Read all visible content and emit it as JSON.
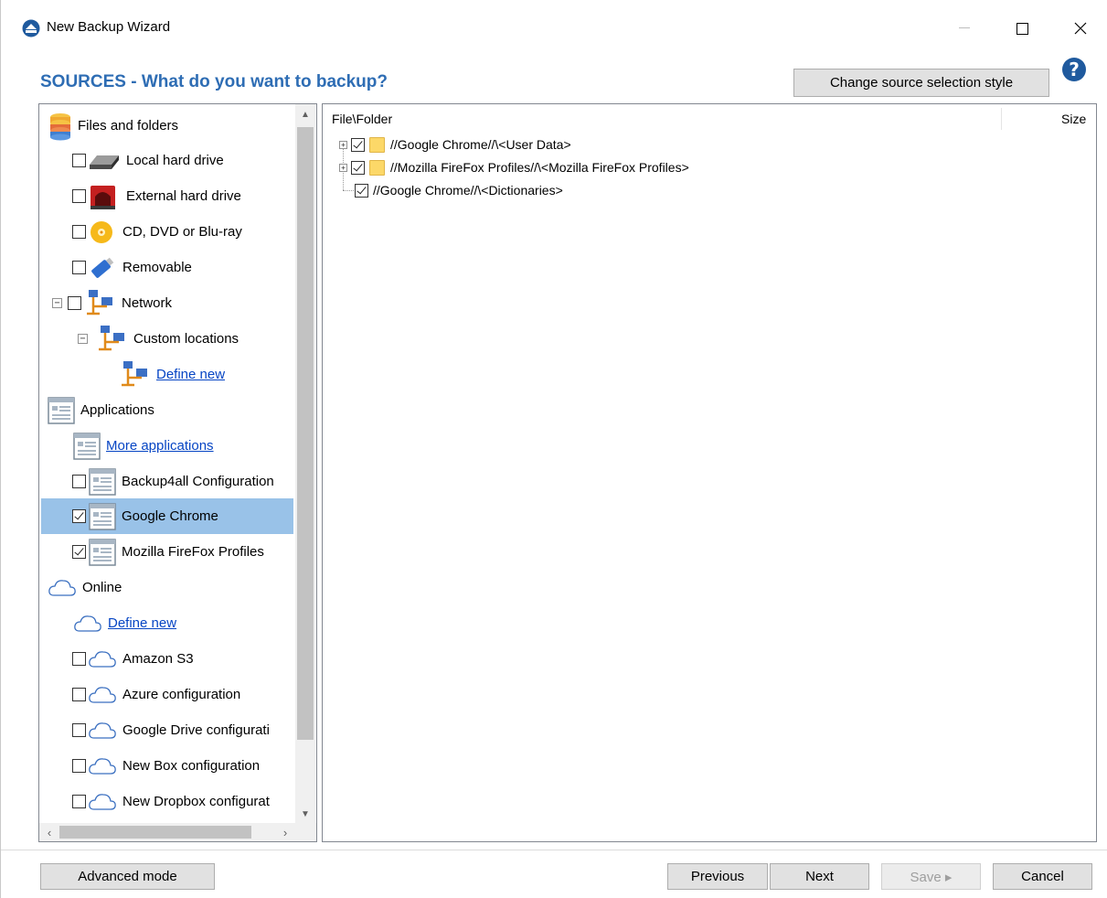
{
  "window": {
    "title": "New Backup Wizard",
    "minimize_label": "—",
    "maximize_label": "☐",
    "close_label": "✕"
  },
  "header": {
    "title": "SOURCES - What do you want to backup?",
    "change_style_label": "Change source selection style",
    "help_label": "?"
  },
  "sources_tree": {
    "items": [
      {
        "label": "Files and folders",
        "icon": "database-icon"
      },
      {
        "label": "Local hard drive",
        "icon": "hard-drive-icon",
        "checked": false
      },
      {
        "label": "External hard drive",
        "icon": "external-drive-icon",
        "checked": false
      },
      {
        "label": "CD, DVD or Blu-ray",
        "icon": "disc-icon",
        "checked": false
      },
      {
        "label": "Removable",
        "icon": "usb-drive-icon",
        "checked": false
      },
      {
        "label": "Network",
        "icon": "network-icon",
        "checked": false,
        "expander": "⊟"
      },
      {
        "label": "Custom locations",
        "icon": "network-icon",
        "expander": "⊟"
      },
      {
        "label": "Define new",
        "icon": "network-icon",
        "link": true
      },
      {
        "label": "Applications",
        "icon": "application-icon"
      },
      {
        "label": "More applications",
        "icon": "application-icon",
        "link": true
      },
      {
        "label": "Backup4all Configuration",
        "icon": "application-icon",
        "checked": false
      },
      {
        "label": "Google Chrome",
        "icon": "application-icon",
        "checked": true,
        "selected": true
      },
      {
        "label": "Mozilla FireFox Profiles",
        "icon": "application-icon",
        "checked": true
      },
      {
        "label": "Online",
        "icon": "cloud-icon"
      },
      {
        "label": "Define new",
        "icon": "cloud-icon",
        "link": true
      },
      {
        "label": "Amazon S3",
        "icon": "cloud-icon",
        "checked": false
      },
      {
        "label": "Azure configuration",
        "icon": "cloud-icon",
        "checked": false
      },
      {
        "label": "Google Drive configurati",
        "icon": "cloud-icon",
        "checked": false
      },
      {
        "label": "New Box configuration",
        "icon": "cloud-icon",
        "checked": false
      },
      {
        "label": "New Dropbox configurat",
        "icon": "cloud-icon",
        "checked": false
      }
    ]
  },
  "file_list": {
    "columns": {
      "name": "File\\Folder",
      "size": "Size"
    },
    "rows": [
      {
        "path": "//Google Chrome//\\<User Data>",
        "checked": true,
        "expandable": true,
        "folder": true
      },
      {
        "path": "//Mozilla FireFox Profiles//\\<Mozilla FireFox Profiles>",
        "checked": true,
        "expandable": true,
        "folder": true
      },
      {
        "path": "//Google Chrome//\\<Dictionaries>",
        "checked": true,
        "expandable": false,
        "folder": false
      }
    ]
  },
  "footer": {
    "advanced_label": "Advanced mode",
    "previous_label": "Previous",
    "next_label": "Next",
    "save_label": "Save ▸",
    "cancel_label": "Cancel"
  },
  "colors": {
    "heading": "#2e6db4",
    "selection": "#99c2e8",
    "link": "#0645c4"
  }
}
